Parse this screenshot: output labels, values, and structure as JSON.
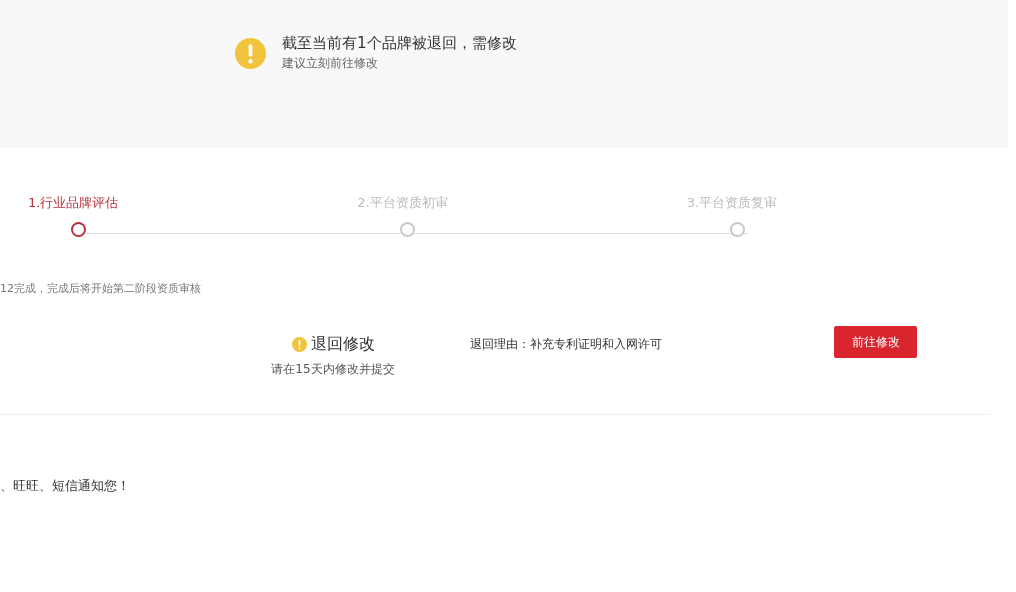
{
  "alert": {
    "title": "截至当前有1个品牌被退回，需修改",
    "subtitle": "建议立刻前往修改"
  },
  "steps": [
    {
      "label": "1.行业品牌评估",
      "selected": true
    },
    {
      "label": "2.平台资质初审",
      "selected": false
    },
    {
      "label": "3.平台资质复审",
      "selected": false
    }
  ],
  "stage_note": "12完成，完成后将开始第二阶段资质审核",
  "result": {
    "status": "退回修改",
    "deadline": "请在15天内修改并提交",
    "reason": "退回理由：补充专利证明和入网许可",
    "button": "前往修改"
  },
  "notice": "、旺旺、短信通知您！"
}
